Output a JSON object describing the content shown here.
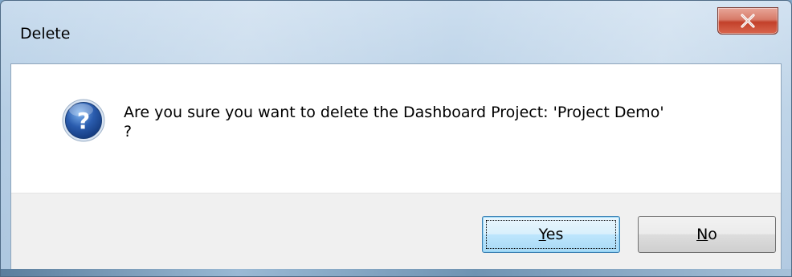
{
  "window": {
    "title": "Delete",
    "close_icon": "close-x-icon"
  },
  "message": {
    "icon": "question-icon",
    "line1": "Are you sure you want to delete the Dashboard Project: 'Project Demo'",
    "line2": "?"
  },
  "buttons": {
    "yes": {
      "accel": "Y",
      "rest": "es",
      "is_default": true
    },
    "no": {
      "accel": "N",
      "rest": "o",
      "is_default": false
    }
  },
  "colors": {
    "close_button": "#c7503a",
    "question_icon": "#2a5cae",
    "button_area_bg": "#f0f0f0",
    "default_button_border": "#3c7fb1"
  }
}
